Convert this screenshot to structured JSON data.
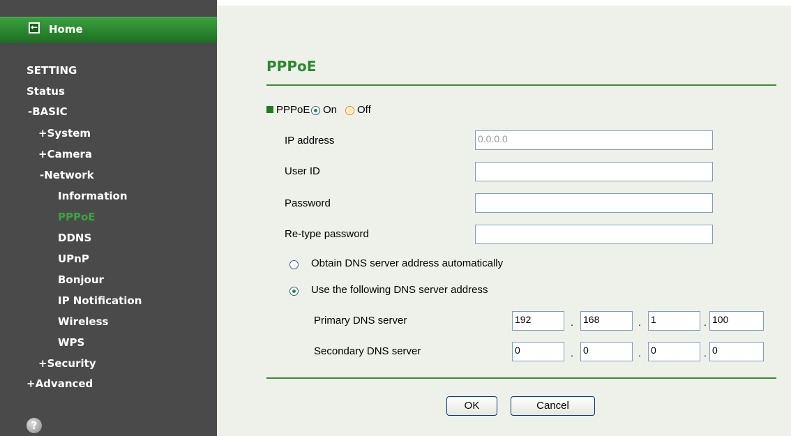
{
  "sidebar": {
    "home_label": "Home",
    "items": [
      {
        "label": "SETTING"
      },
      {
        "label": "Status"
      },
      {
        "label": "-BASIC"
      },
      {
        "label": "+System"
      },
      {
        "label": "+Camera"
      },
      {
        "label": "-Network"
      },
      {
        "label": "Information"
      },
      {
        "label": "PPPoE"
      },
      {
        "label": "DDNS"
      },
      {
        "label": "UPnP"
      },
      {
        "label": "Bonjour"
      },
      {
        "label": "IP Notification"
      },
      {
        "label": "Wireless"
      },
      {
        "label": "WPS"
      },
      {
        "label": "+Security"
      },
      {
        "label": "+Advanced"
      }
    ],
    "help_glyph": "?"
  },
  "main": {
    "title": "PPPoE",
    "pppoe_toggle": {
      "label": "PPPoE",
      "on_label": "On",
      "off_label": "Off",
      "selected": "On"
    },
    "fields": {
      "ip_address": {
        "label": "IP address",
        "value": "0.0.0.0"
      },
      "user_id": {
        "label": "User ID",
        "value": ""
      },
      "password": {
        "label": "Password",
        "value": ""
      },
      "retype_password": {
        "label": "Re-type password",
        "value": ""
      }
    },
    "dns": {
      "auto_label": "Obtain DNS server address automatically",
      "manual_label": "Use the following DNS server address",
      "selected": "manual",
      "primary": {
        "label": "Primary DNS server",
        "octets": [
          "192",
          "168",
          "1",
          "100"
        ]
      },
      "secondary": {
        "label": "Secondary DNS server",
        "octets": [
          "0",
          "0",
          "0",
          "0"
        ]
      },
      "separator": "."
    },
    "buttons": {
      "ok": "OK",
      "cancel": "Cancel"
    }
  }
}
